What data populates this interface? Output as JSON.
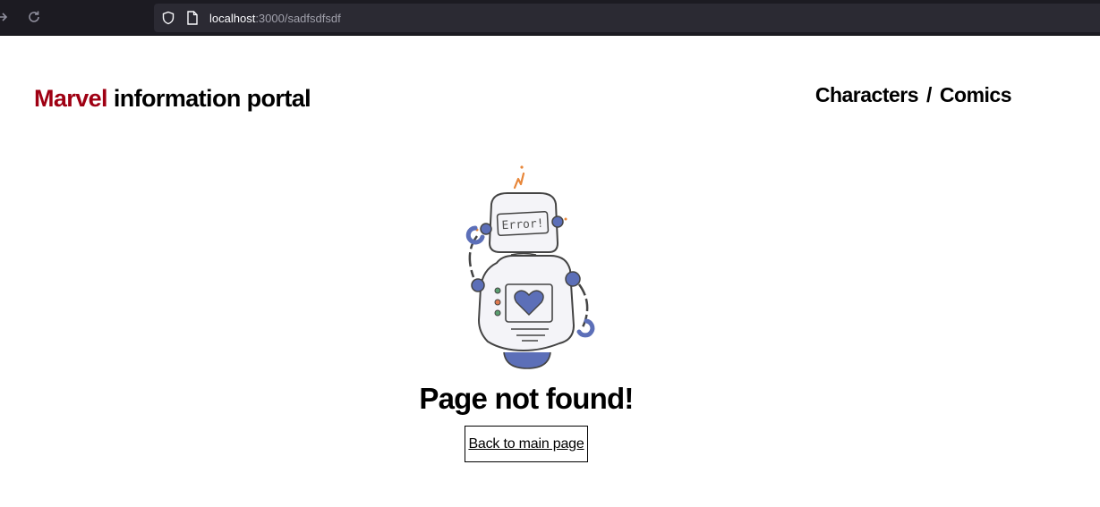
{
  "browser": {
    "url_host": "localhost",
    "url_rest": ":3000/sadfsdfsdf",
    "icons": {
      "forward": "arrow-right-icon",
      "reload": "reload-icon",
      "security": "shield-icon",
      "page": "page-icon"
    }
  },
  "header": {
    "brand": "Marvel",
    "title_rest": " information portal",
    "nav": {
      "characters": "Characters",
      "separator": "/",
      "comics": "Comics"
    }
  },
  "error_page": {
    "image_text": "Error!",
    "title": "Page not found!",
    "back_link": "Back to main page"
  },
  "colors": {
    "brand_red": "#9f0013",
    "robot_blue": "#5c6fb8",
    "browser_dark": "#1c1b22"
  }
}
